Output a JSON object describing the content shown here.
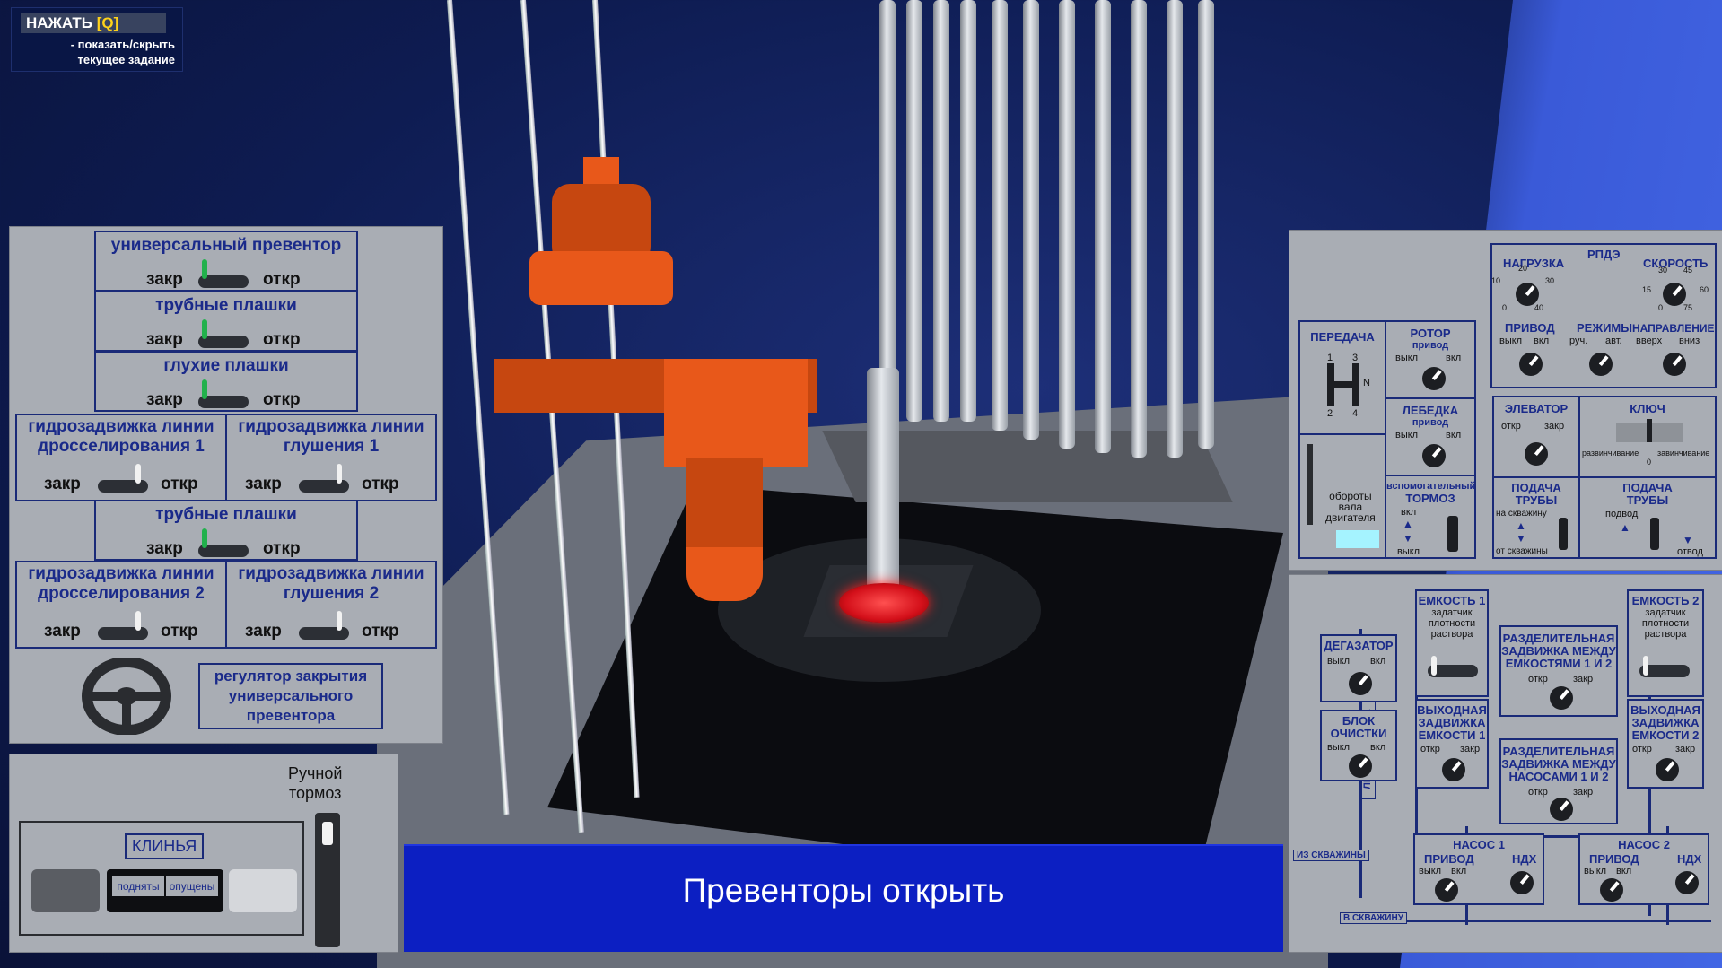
{
  "hint": {
    "key_prefix": "НАЖАТЬ",
    "key": "[Q]",
    "line1": "- показать/скрыть",
    "line2": "текущее задание"
  },
  "task": {
    "text": "Превенторы открыть"
  },
  "left_panel": {
    "universal_preventer": {
      "title": "универсальный превентор",
      "closed": "закр",
      "open": "откр"
    },
    "pipe_rams_1": {
      "title": "трубные плашки",
      "closed": "закр",
      "open": "откр"
    },
    "blind_rams": {
      "title": "глухие плашки",
      "closed": "закр",
      "open": "откр"
    },
    "choke_valve_1": {
      "title_l1": "гидрозадвижка линии",
      "title_l2": "дросселирования 1",
      "closed": "закр",
      "open": "откр"
    },
    "kill_valve_1": {
      "title_l1": "гидрозадвижка линии",
      "title_l2": "глушения 1",
      "closed": "закр",
      "open": "откр"
    },
    "pipe_rams_2": {
      "title": "трубные плашки",
      "closed": "закр",
      "open": "откр"
    },
    "choke_valve_2": {
      "title_l1": "гидрозадвижка линии",
      "title_l2": "дросселирования 2",
      "closed": "закр",
      "open": "откр"
    },
    "kill_valve_2": {
      "title_l1": "гидрозадвижка линии",
      "title_l2": "глушения 2",
      "closed": "закр",
      "open": "откр"
    },
    "regulator": {
      "l1": "регулятор закрытия",
      "l2": "универсального",
      "l3": "превентора"
    }
  },
  "bottom_left": {
    "brake_l1": "Ручной",
    "brake_l2": "тормоз",
    "wedges": "КЛИНЬЯ",
    "raised": "подняты",
    "lowered": "опущены"
  },
  "right_panel": {
    "gear": {
      "title": "ПЕРЕДАЧА",
      "n1": "1",
      "n3": "3",
      "n2": "2",
      "n4": "4",
      "nN": "N"
    },
    "rpm": {
      "l1": "обороты",
      "l2": "вала",
      "l3": "двигателя"
    },
    "rotor": {
      "title": "РОТОР",
      "sub": "привод",
      "off": "выкл",
      "on": "вкл"
    },
    "winch": {
      "title": "ЛЕБЕДКА",
      "sub": "привод",
      "off": "выкл",
      "on": "вкл"
    },
    "aux_brake": {
      "title_l1": "вспомогательный",
      "title_l2": "ТОРМОЗ",
      "on": "вкл",
      "off": "выкл"
    },
    "rpde": {
      "title": "РПДЭ",
      "load": "НАГРУЗКА",
      "speed": "СКОРОСТЬ",
      "load_ticks": [
        "20",
        "10",
        "30",
        "0",
        "40"
      ],
      "speed_ticks": [
        "30",
        "45",
        "15",
        "60",
        "0",
        "75"
      ],
      "drive": "ПРИВОД",
      "drive_off": "выкл",
      "drive_on": "вкл",
      "modes": "РЕЖИМЫ",
      "manual": "руч.",
      "auto": "авт.",
      "direction": "НАПРАВЛЕНИЕ",
      "up": "вверх",
      "down": "вниз"
    },
    "elevator": {
      "title": "ЭЛЕВАТОР",
      "open": "откр",
      "close": "закр"
    },
    "key": {
      "title": "КЛЮЧ",
      "unscrew": "развинчивание",
      "screw": "завинчивание",
      "zero": "0"
    },
    "pipe_feed_1": {
      "l1": "ПОДАЧА",
      "l2": "ТРУБЫ",
      "to_well": "на скважину",
      "from_well": "от скважины"
    },
    "pipe_feed_2": {
      "l1": "ПОДАЧА",
      "l2": "ТРУБЫ",
      "feed": "подвод",
      "retract": "отвод"
    }
  },
  "mud_panel": {
    "degasser": {
      "title": "ДЕГАЗАТОР",
      "off": "выкл",
      "on": "вкл"
    },
    "cleaning": {
      "l1": "БЛОК",
      "l2": "ОЧИСТКИ",
      "off": "выкл",
      "on": "вкл"
    },
    "dump_line": "ЛИНИЯ СБРОСА",
    "from_well": "ИЗ СКВАЖИНЫ",
    "to_well": "В СКВАЖИНУ",
    "tank1": {
      "l1": "ЕМКОСТЬ 1",
      "l2": "задатчик",
      "l3": "плотности",
      "l4": "раствора"
    },
    "tank2": {
      "l1": "ЕМКОСТЬ 2",
      "l2": "задатчик",
      "l3": "плотности",
      "l4": "раствора"
    },
    "sep_tanks": {
      "l1": "РАЗДЕЛИТЕЛЬНАЯ",
      "l2": "ЗАДВИЖКА МЕЖДУ",
      "l3": "ЕМКОСТЯМИ 1 И 2",
      "open": "откр",
      "close": "закр"
    },
    "out_valve1": {
      "l1": "ВЫХОДНАЯ",
      "l2": "ЗАДВИЖКА",
      "l3": "ЕМКОСТИ 1",
      "open": "откр",
      "close": "закр"
    },
    "out_valve2": {
      "l1": "ВЫХОДНАЯ",
      "l2": "ЗАДВИЖКА",
      "l3": "ЕМКОСТИ 2",
      "open": "откр",
      "close": "закр"
    },
    "sep_pumps": {
      "l1": "РАЗДЕЛИТЕЛЬНАЯ",
      "l2": "ЗАДВИЖКА МЕЖДУ",
      "l3": "НАСОСАМИ 1 И 2",
      "open": "откр",
      "close": "закр"
    },
    "pump1": {
      "title": "НАСОС 1",
      "drive": "ПРИВОД",
      "off": "выкл",
      "on": "вкл",
      "ndh": "НДХ"
    },
    "pump2": {
      "title": "НАСОС 2",
      "drive": "ПРИВОД",
      "off": "выкл",
      "on": "вкл",
      "ndh": "НДХ"
    }
  }
}
